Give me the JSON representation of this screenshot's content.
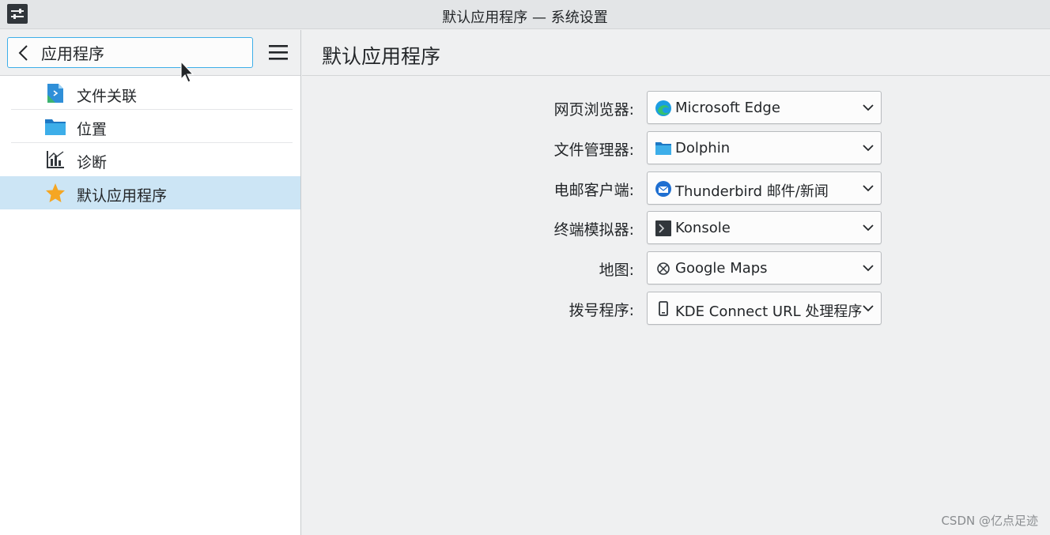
{
  "window": {
    "title": "默认应用程序 — 系统设置",
    "app_icon": "system-settings-icon"
  },
  "sidebar": {
    "back_label": "应用程序",
    "menu_icon": "hamburger-menu-icon",
    "items": [
      {
        "label": "文件关联",
        "icon": "file-associations-icon",
        "selected": false
      },
      {
        "label": "位置",
        "icon": "folder-icon",
        "selected": false
      },
      {
        "label": "诊断",
        "icon": "diagnostics-icon",
        "selected": false
      },
      {
        "label": "默认应用程序",
        "icon": "star-icon",
        "selected": true
      }
    ]
  },
  "main": {
    "title": "默认应用程序",
    "rows": [
      {
        "label": "网页浏览器:",
        "value": "Microsoft Edge",
        "icon": "edge-icon"
      },
      {
        "label": "文件管理器:",
        "value": "Dolphin",
        "icon": "folder-icon"
      },
      {
        "label": "电邮客户端:",
        "value": "Thunderbird 邮件/新闻",
        "icon": "thunderbird-icon"
      },
      {
        "label": "终端模拟器:",
        "value": "Konsole",
        "icon": "terminal-icon"
      },
      {
        "label": "地图:",
        "value": "Google Maps",
        "icon": "maps-icon"
      },
      {
        "label": "拨号程序:",
        "value": "KDE Connect URL 处理程序",
        "icon": "phone-icon"
      }
    ]
  },
  "watermark": "CSDN @亿点足迹",
  "colors": {
    "accent": "#3daee9",
    "selection": "#cce5f5",
    "star": "#f5a623"
  }
}
